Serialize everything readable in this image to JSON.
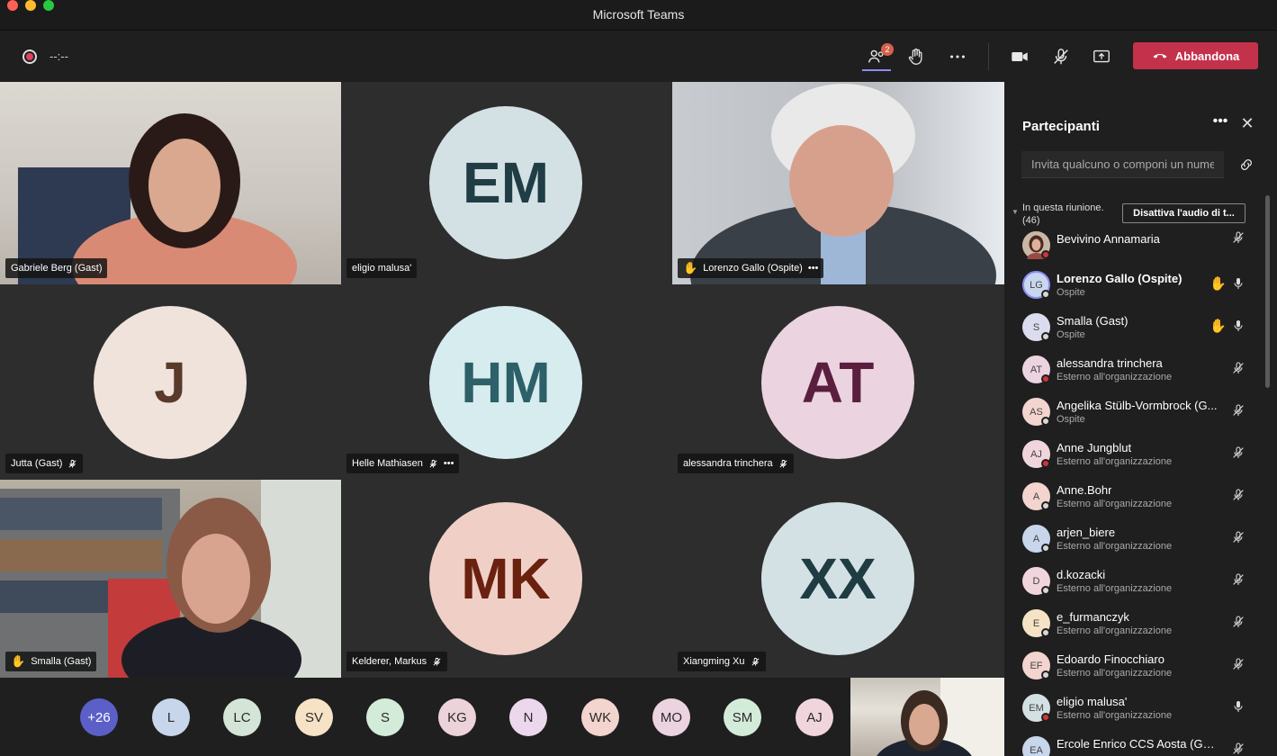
{
  "window": {
    "title": "Microsoft Teams"
  },
  "toolbar": {
    "timer": "--:--",
    "participants_count_badge": "2",
    "leave_label": "Abbandona",
    "accent": "#c4314b"
  },
  "tiles": [
    {
      "name": "Gabriele Berg (Gast)",
      "type": "video"
    },
    {
      "name": "eligio malusa'",
      "type": "avatar",
      "initials": "EM"
    },
    {
      "name": "Lorenzo Gallo (Ospite)",
      "type": "video"
    },
    {
      "name": "Jutta (Gast)",
      "type": "avatar",
      "initials": "J"
    },
    {
      "name": "Helle Mathiasen",
      "type": "avatar",
      "initials": "HM"
    },
    {
      "name": "alessandra trinchera",
      "type": "avatar",
      "initials": "AT"
    },
    {
      "name": "Smalla (Gast)",
      "type": "video"
    },
    {
      "name": "Kelderer, Markus",
      "type": "avatar",
      "initials": "MK"
    },
    {
      "name": "Xiangming Xu",
      "type": "avatar",
      "initials": "XX"
    }
  ],
  "strip": {
    "overflow": "+26",
    "avatars": [
      "L",
      "LC",
      "SV",
      "S",
      "KG",
      "N",
      "WK",
      "MO",
      "SM",
      "AJ"
    ]
  },
  "panel": {
    "title": "Partecipanti",
    "invite_placeholder": "Invita qualcuno o componi un numero",
    "section_label": "In questa riunione (46)",
    "section_label_line1": "In questa riunione.",
    "section_label_line2": "(46)",
    "mute_all": "Disattiva l'audio di t...",
    "participants": [
      {
        "name": "Bevivino Annamaria",
        "sub": "",
        "initials": "",
        "hand": false,
        "muted": true
      },
      {
        "name": "Lorenzo Gallo (Ospite)",
        "sub": "Ospite",
        "initials": "LG",
        "hand": true,
        "muted": false
      },
      {
        "name": "Smalla (Gast)",
        "sub": "Ospite",
        "initials": "S",
        "hand": true,
        "muted": false
      },
      {
        "name": "alessandra trinchera",
        "sub": "Esterno all'organizzazione",
        "initials": "AT",
        "hand": false,
        "muted": true
      },
      {
        "name": "Angelika Stülb-Vormbrock (G...",
        "sub": "Ospite",
        "initials": "AS",
        "hand": false,
        "muted": true
      },
      {
        "name": "Anne Jungblut",
        "sub": "Esterno all'organizzazione",
        "initials": "AJ",
        "hand": false,
        "muted": true
      },
      {
        "name": "Anne.Bohr",
        "sub": "Esterno all'organizzazione",
        "initials": "A",
        "hand": false,
        "muted": true
      },
      {
        "name": "arjen_biere",
        "sub": "Esterno all'organizzazione",
        "initials": "A",
        "hand": false,
        "muted": true
      },
      {
        "name": "d.kozacki",
        "sub": "Esterno all'organizzazione",
        "initials": "D",
        "hand": false,
        "muted": true
      },
      {
        "name": "e_furmanczyk",
        "sub": "Esterno all'organizzazione",
        "initials": "E",
        "hand": false,
        "muted": true
      },
      {
        "name": "Edoardo Finocchiaro",
        "sub": "Esterno all'organizzazione",
        "initials": "EF",
        "hand": false,
        "muted": true
      },
      {
        "name": "eligio malusa'",
        "sub": "Esterno all'organizzazione",
        "initials": "EM",
        "hand": false,
        "muted": false
      },
      {
        "name": "Ercole Enrico CCS Aosta (Guest)",
        "sub": "",
        "initials": "EA",
        "hand": false,
        "muted": true
      }
    ]
  }
}
